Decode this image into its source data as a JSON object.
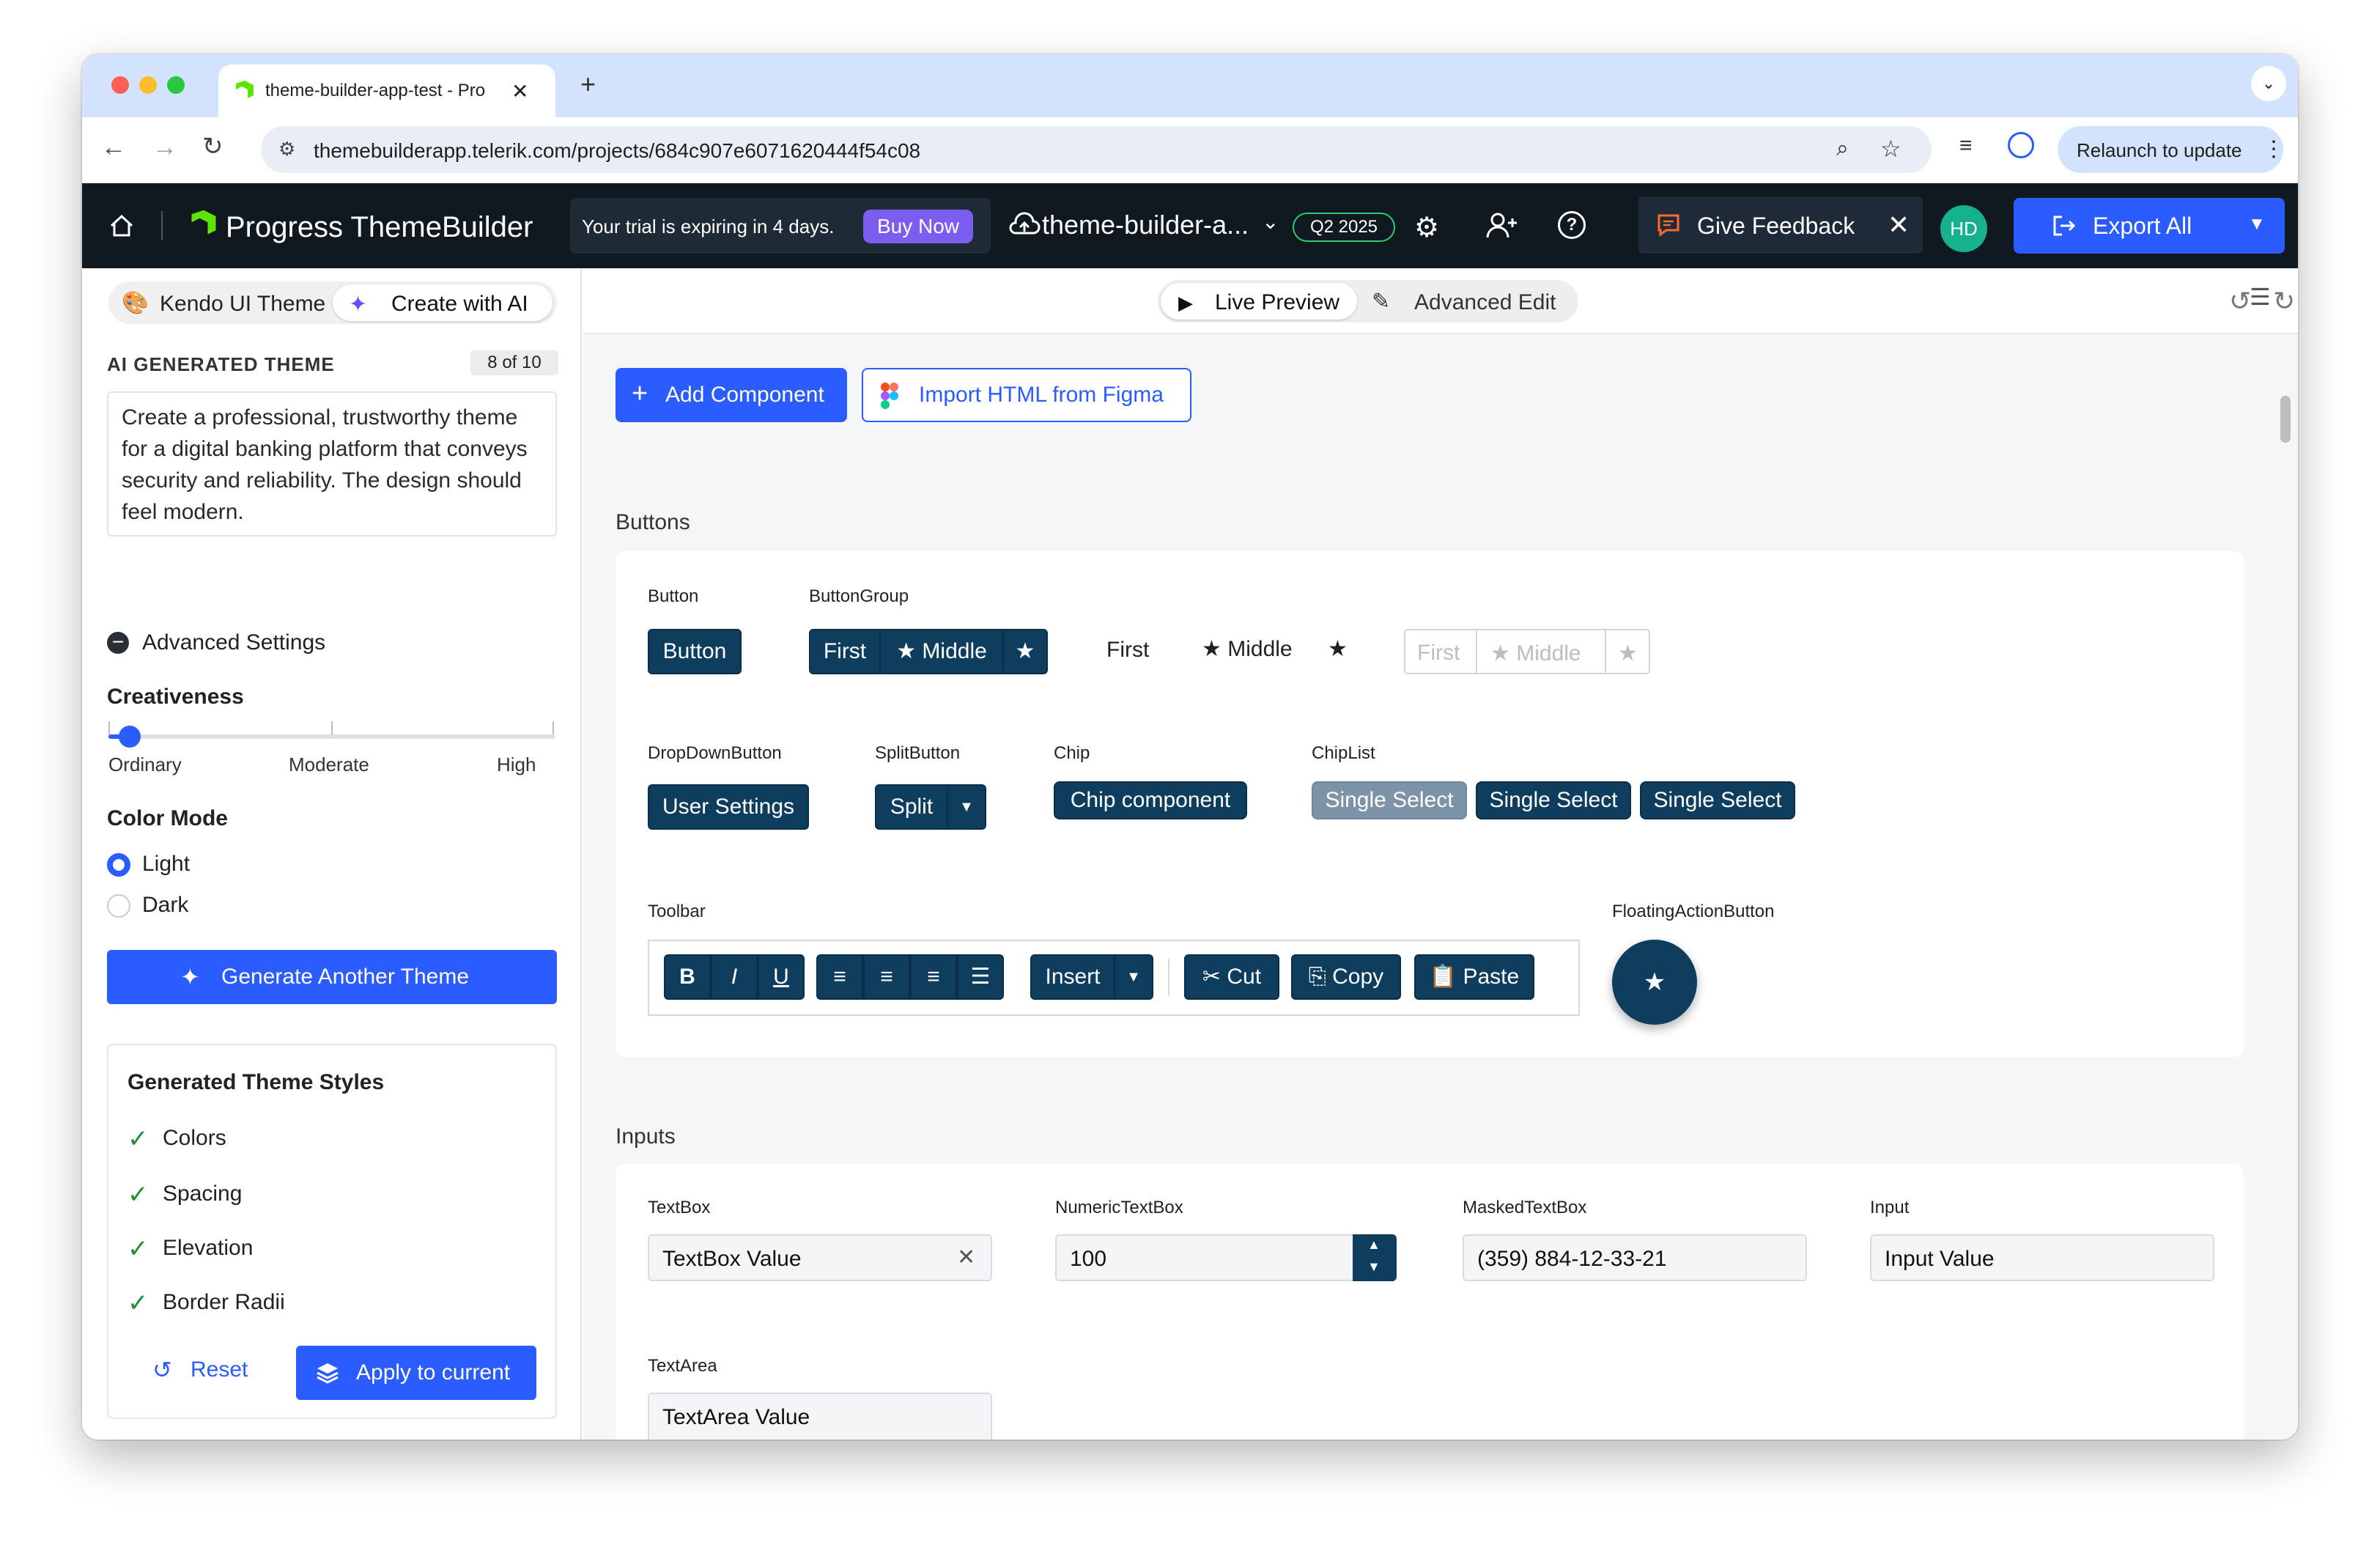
{
  "browser": {
    "tab_title": "theme-builder-app-test - Pro",
    "url": "themebuilderapp.telerik.com/projects/684c907e6071620444f54c08",
    "relaunch_label": "Relaunch to update"
  },
  "app_header": {
    "logo_text": "Progress ThemeBuilder",
    "trial_text": "Your trial is expiring in 4 days.",
    "buy_now": "Buy Now",
    "project_name": "theme-builder-a...",
    "version_badge": "Q2 2025",
    "feedback_label": "Give Feedback",
    "avatar_initials": "HD",
    "export_label": "Export All"
  },
  "left_panel": {
    "theme_tab_kendo": "Kendo UI Theme",
    "theme_tab_ai": "Create with AI",
    "section_title": "AI GENERATED THEME",
    "count": "8 of 10",
    "prompt": "Create a professional, trustworthy theme for a digital banking platform that conveys security and reliability. The design should feel modern.",
    "advanced_settings": "Advanced Settings",
    "creativeness_label": "Creativeness",
    "slider_labels": [
      "Ordinary",
      "Moderate",
      "High"
    ],
    "slider_value": 0.05,
    "color_mode_label": "Color Mode",
    "color_modes": [
      "Light",
      "Dark"
    ],
    "selected_mode": "Light",
    "generate_button": "Generate Another Theme",
    "styles_title": "Generated Theme Styles",
    "styles": [
      "Colors",
      "Spacing",
      "Elevation",
      "Border Radii"
    ],
    "reset_button": "Reset",
    "apply_button": "Apply to current"
  },
  "main": {
    "live_preview": "Live Preview",
    "advanced_edit": "Advanced Edit",
    "add_component": "Add Component",
    "import_figma": "Import HTML from Figma",
    "buttons_section": "Buttons",
    "inputs_section": "Inputs",
    "button_label": "Button",
    "button_text": "Button",
    "buttongroup_label": "ButtonGroup",
    "bg_first": "First",
    "bg_middle": "Middle",
    "dropdown_label": "DropDownButton",
    "dropdown_text": "User Settings",
    "split_label": "SplitButton",
    "split_text": "Split",
    "chip_label": "Chip",
    "chip_text": "Chip component",
    "chiplist_label": "ChipList",
    "chiplist_items": [
      "Single Select",
      "Single Select",
      "Single Select"
    ],
    "toolbar_label": "Toolbar",
    "toolbar_insert": "Insert",
    "toolbar_cut": "Cut",
    "toolbar_copy": "Copy",
    "toolbar_paste": "Paste",
    "fab_label": "FloatingActionButton",
    "textbox_label": "TextBox",
    "textbox_value": "TextBox Value",
    "numeric_label": "NumericTextBox",
    "numeric_value": "100",
    "masked_label": "MaskedTextBox",
    "masked_value": "(359) 884-12-33-21",
    "input_label": "Input",
    "input_value": "Input Value",
    "textarea_label": "TextArea",
    "textarea_value": "TextArea Value"
  },
  "colors": {
    "primary": "#2b5cff",
    "component": "#0f3d5e",
    "header_bg": "#101820"
  }
}
